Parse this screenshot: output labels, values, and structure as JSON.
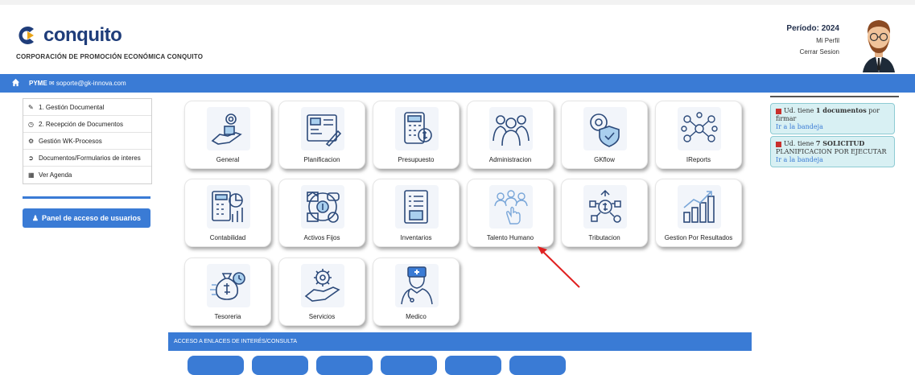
{
  "header": {
    "logo_text": "conquito",
    "corp_name": "CORPORACIÓN DE PROMOCIÓN ECONÓMICA CONQUITO",
    "periodo": "Período: 2024",
    "mi_perfil": "Mi Perfil",
    "cerrar_sesion": "Cerrar Sesion"
  },
  "userbar": {
    "role": "PYME",
    "email": "soporte@gk-innova.com"
  },
  "menu": {
    "items": [
      {
        "icon": "pencil-icon",
        "label": "1. Gestión Documental"
      },
      {
        "icon": "clock-icon",
        "label": "2. Recepción de Documentos"
      },
      {
        "icon": "gear-icon",
        "label": "Gestión WK-Procesos"
      },
      {
        "icon": "circle-arrow-icon",
        "label": "Documentos/Formularios de interes"
      },
      {
        "icon": "calendar-icon",
        "label": "Ver Agenda"
      }
    ],
    "panel_button": "Panel de acceso de usuarios"
  },
  "tiles": [
    {
      "label": "General",
      "icon": "gear-hand-icon"
    },
    {
      "label": "Planificacion",
      "icon": "blueprint-icon"
    },
    {
      "label": "Presupuesto",
      "icon": "calculator-dollar-icon"
    },
    {
      "label": "Administracion",
      "icon": "team-icon"
    },
    {
      "label": "GKflow",
      "icon": "gear-shield-icon"
    },
    {
      "label": "IReports",
      "icon": "network-icon"
    },
    {
      "label": "Contabilidad",
      "icon": "calculator-chart-icon"
    },
    {
      "label": "Activos Fijos",
      "icon": "assets-icon"
    },
    {
      "label": "Inventarios",
      "icon": "inventory-icon"
    },
    {
      "label": "Talento Humano",
      "icon": "people-touch-icon"
    },
    {
      "label": "Tributacion",
      "icon": "tax-network-icon"
    },
    {
      "label": "Gestion Por Resultados",
      "icon": "growth-bars-icon"
    },
    {
      "label": "Tesoreria",
      "icon": "money-bag-icon"
    },
    {
      "label": "Servicios",
      "icon": "service-hand-icon"
    },
    {
      "label": "Medico",
      "icon": "doctor-icon"
    }
  ],
  "notifications": [
    {
      "line1_pre": "Ud. tiene ",
      "line1_bold": "1 documentos",
      "line1_post": " por",
      "line2": "firmar",
      "link": "Ir a la bandeja"
    },
    {
      "line1_pre": "Ud. tiene ",
      "line1_bold": "7 SOLICITUD",
      "line1_post": "",
      "line2": "PLANIFICACION POR EJECUTAR",
      "link": "Ir a la bandeja"
    }
  ],
  "acceso_title": "ACCESO A ENLACES DE INTERÉS/CONSULTA",
  "colors": {
    "brand_blue": "#3a7bd5",
    "logo_navy": "#1f3d7a",
    "notif_bg": "#d8f0f3",
    "alert_red": "#c9302c",
    "arrow_red": "#e02020"
  }
}
